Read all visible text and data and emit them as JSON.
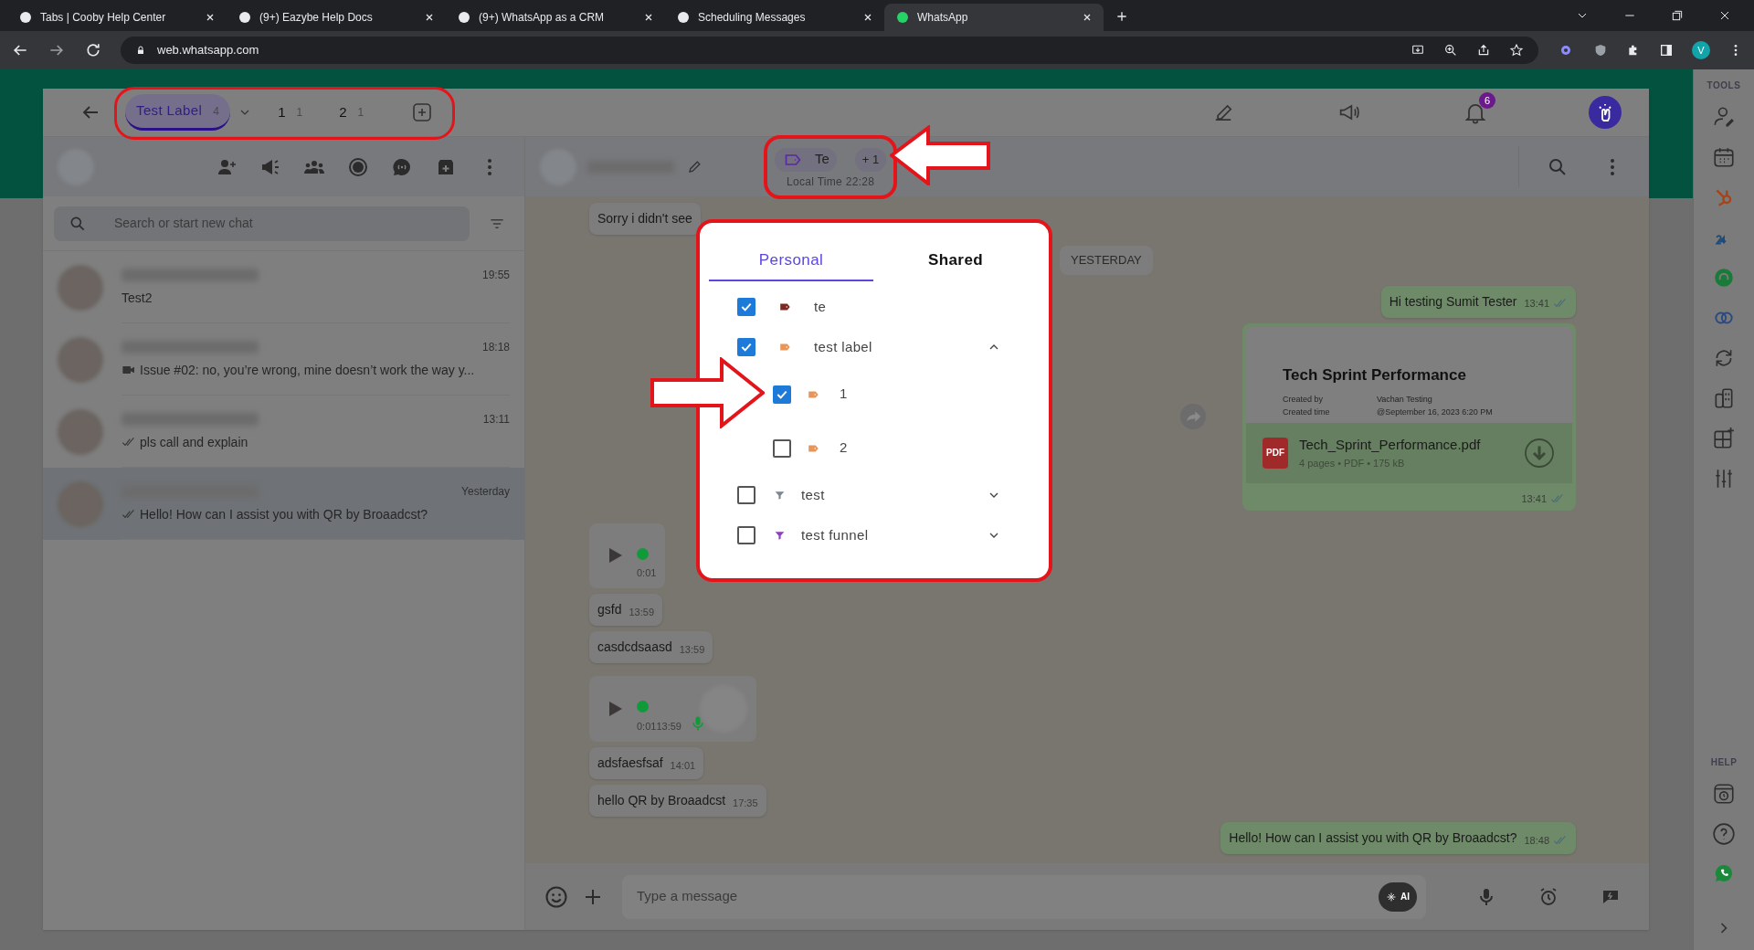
{
  "browser": {
    "tabs": [
      {
        "title": "Tabs | Cooby Help Center",
        "selected": false
      },
      {
        "title": "(9+) Eazybe Help Docs",
        "selected": false
      },
      {
        "title": "(9+) WhatsApp as a CRM",
        "selected": false
      },
      {
        "title": "Scheduling Messages",
        "selected": false
      },
      {
        "title": "WhatsApp",
        "selected": true
      }
    ],
    "url": "web.whatsapp.com",
    "profile_initial": "V"
  },
  "label_bar": {
    "tabs": [
      {
        "label": "Test Label",
        "count": "4",
        "selected": true
      },
      {
        "label": "1",
        "count": "1",
        "selected": false
      },
      {
        "label": "2",
        "count": "1",
        "selected": false
      }
    ],
    "notification_count": "6"
  },
  "chat_list": {
    "search": {
      "placeholder": "Search or start new chat"
    },
    "chats": [
      {
        "preview": "Test2",
        "time": "19:55",
        "ticks": false,
        "video": false,
        "selected": false
      },
      {
        "preview": "Issue #02: no, you’re wrong, mine doesn’t work the way y...",
        "time": "18:18",
        "ticks": false,
        "video": true,
        "selected": false
      },
      {
        "preview": "pls call and explain",
        "time": "13:11",
        "ticks": true,
        "video": false,
        "selected": false
      },
      {
        "preview": "Hello! How can I assist you with QR by Broaadcst?",
        "time": "Yesterday",
        "ticks": true,
        "video": false,
        "selected": true
      }
    ]
  },
  "conversation": {
    "labels": {
      "chip": "Te",
      "more": "+ 1",
      "local_time": "Local Time 22:28"
    },
    "messages": [
      {
        "kind": "incoming",
        "text": "Sorry i didn't see"
      },
      {
        "kind": "date",
        "text": "YESTERDAY"
      },
      {
        "kind": "outgoing",
        "text": "Hi testing Sumit Tester",
        "time": "13:41",
        "ticks": true
      },
      {
        "kind": "document",
        "title": "Tech Sprint Performance",
        "created_by_label": "Created by",
        "created_by": "Vachan Testing",
        "created_time_label": "Created time",
        "created_time": "@September 16, 2023 6:20 PM",
        "file_name": "Tech_Sprint_Performance.pdf",
        "meta": "4 pages • PDF • 175 kB",
        "file_type": "PDF",
        "time": "13:41",
        "ticks": true
      },
      {
        "kind": "audio",
        "duration": "0:01",
        "level": 0
      },
      {
        "kind": "incoming",
        "text": "gsfd",
        "time": "13:59"
      },
      {
        "kind": "incoming",
        "text": "casdcdsaasd",
        "time": "13:59"
      },
      {
        "kind": "audio",
        "duration": "0:01",
        "time": "13:59",
        "level": 0
      },
      {
        "kind": "incoming",
        "text": "adsfaesfsaf",
        "time": "14:01"
      },
      {
        "kind": "incoming",
        "text": "hello QR by Broaadcst",
        "time": "17:35"
      },
      {
        "kind": "outgoing",
        "text": "Hello! How can I assist you with QR by Broaadcst?",
        "time": "18:48",
        "ticks": true
      }
    ],
    "composer": {
      "placeholder": "Type a message",
      "ai_badge": "AI"
    }
  },
  "label_popup": {
    "tabs": [
      {
        "label": "Personal",
        "selected": true
      },
      {
        "label": "Shared",
        "selected": false
      }
    ],
    "items": [
      {
        "kind": "tag",
        "label": "te",
        "color": "#7a2a22",
        "checked": true
      },
      {
        "kind": "tag",
        "label": "test label",
        "color": "#e8955a",
        "checked": true,
        "expanded": true,
        "children": [
          {
            "kind": "tag",
            "label": "1",
            "color": "#e8955a",
            "checked": true
          },
          {
            "kind": "tag",
            "label": "2",
            "color": "#e8955a",
            "checked": false
          }
        ]
      },
      {
        "kind": "funnel",
        "label": "test",
        "color": "#7d8590",
        "checked": false,
        "expanded": false
      },
      {
        "kind": "funnel",
        "label": "test funnel",
        "color": "#8e3fc0",
        "checked": false,
        "expanded": false
      }
    ]
  },
  "tools_sidebar": {
    "tools_heading": "TOOLS",
    "help_heading": "HELP"
  },
  "annotations": [
    {
      "kind": "arrow"
    },
    {
      "kind": "arrow"
    }
  ]
}
